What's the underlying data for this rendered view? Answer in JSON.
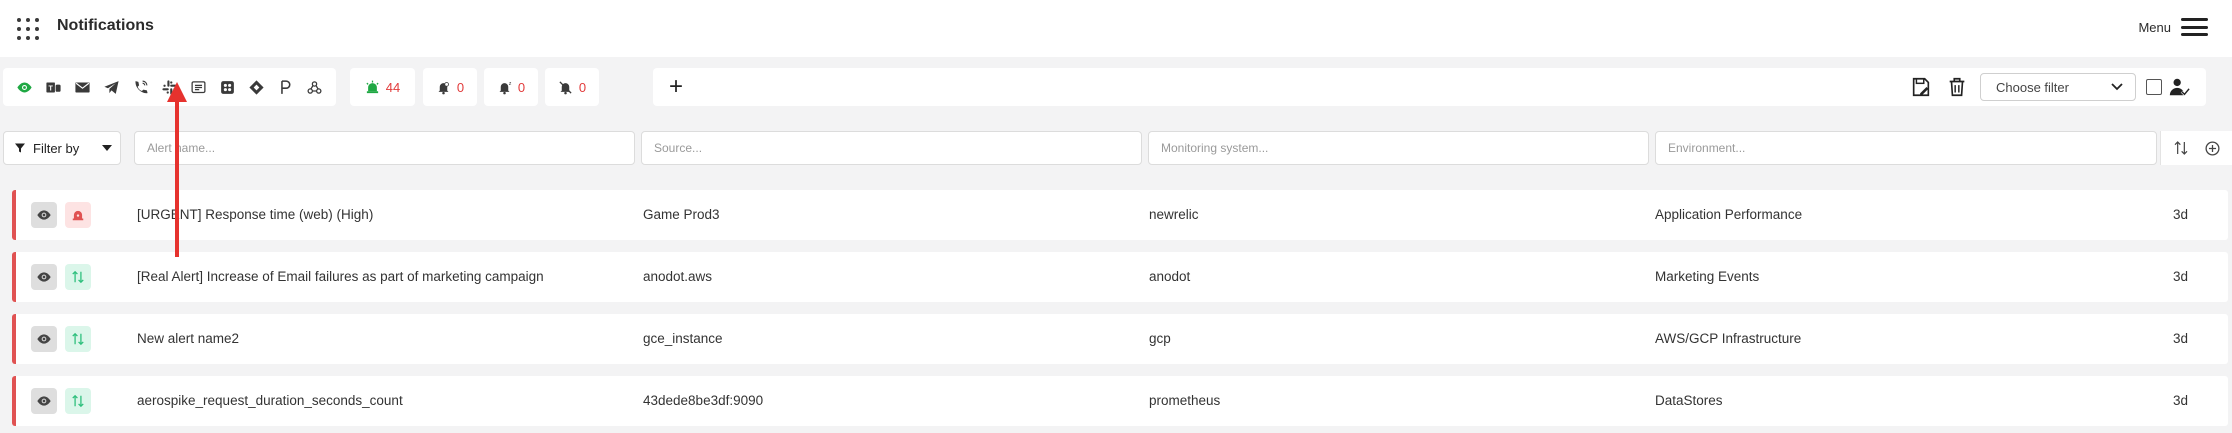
{
  "header": {
    "title": "Notifications",
    "menu_label": "Menu"
  },
  "toolbar": {
    "channels": [
      {
        "icon": "eye-icon"
      },
      {
        "icon": "teams-icon"
      },
      {
        "icon": "email-icon"
      },
      {
        "icon": "telegram-icon"
      },
      {
        "icon": "phone-icon"
      },
      {
        "icon": "slack-icon"
      },
      {
        "icon": "sms-icon"
      },
      {
        "icon": "opsgenie-icon"
      },
      {
        "icon": "jira-icon"
      },
      {
        "icon": "pagerduty-icon"
      },
      {
        "icon": "webhook-icon"
      }
    ],
    "counts": {
      "active": "44",
      "acknowledged": "0",
      "snoozed": "0",
      "muted": "0"
    },
    "filter_select": "Choose filter"
  },
  "filters": {
    "filter_by_label": "Filter by",
    "alert_name_placeholder": "Alert name...",
    "source_placeholder": "Source...",
    "monitoring_placeholder": "Monitoring system...",
    "environment_placeholder": "Environment..."
  },
  "alerts": [
    {
      "name": "[URGENT] Response time (web) (High)",
      "source": "Game Prod3",
      "monitoring": "newrelic",
      "environment": "Application Performance",
      "age": "3d",
      "severity_icon": "siren-icon"
    },
    {
      "name": "[Real Alert] Increase of Email failures as part of marketing campaign",
      "source": "anodot.aws",
      "monitoring": "anodot",
      "environment": "Marketing Events",
      "age": "3d",
      "severity_icon": "sort-arrows-icon"
    },
    {
      "name": "New alert name2",
      "source": "gce_instance",
      "monitoring": "gcp",
      "environment": "AWS/GCP Infrastructure",
      "age": "3d",
      "severity_icon": "sort-arrows-icon"
    },
    {
      "name": "aerospike_request_duration_seconds_count",
      "source": "43dede8be3df:9090",
      "monitoring": "prometheus",
      "environment": "DataStores",
      "age": "3d",
      "severity_icon": "sort-arrows-icon"
    }
  ],
  "colors": {
    "accent_red": "#e05252",
    "eye_green": "#1fa843",
    "count_red": "#e23b3b",
    "annotation_arrow": "#e6322e"
  }
}
